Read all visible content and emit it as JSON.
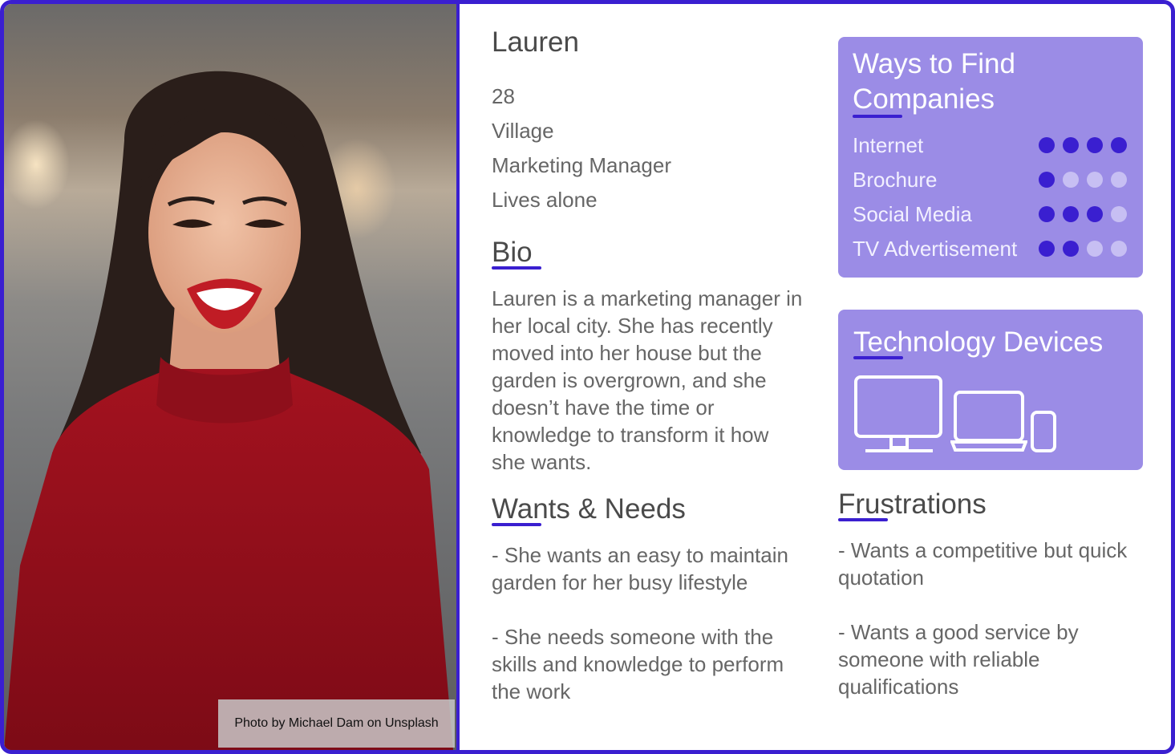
{
  "persona": {
    "name": "Lauren",
    "facts": [
      "28",
      "Village",
      "Marketing Manager",
      "Lives alone"
    ]
  },
  "photo": {
    "credit": "Photo by Michael Dam on Unsplash"
  },
  "bio": {
    "heading": "Bio",
    "text": "Lauren is a marketing manager in\nher local city. She has recently\nmoved into her house but the\ngarden is overgrown, and she\ndoesn’t have the time or\nknowledge to transform it how\nshe wants."
  },
  "wants": {
    "heading": "Wants & Needs",
    "items": [
      "- She wants an easy to maintain\ngarden for her busy lifestyle",
      "- She needs someone with the\nskills and knowledge to perform\nthe work"
    ]
  },
  "ways": {
    "title": "Ways to Find\nCompanies",
    "rows": [
      {
        "label": "Internet",
        "level": 4,
        "max": 4
      },
      {
        "label": "Brochure",
        "level": 1,
        "max": 4
      },
      {
        "label": "Social Media",
        "level": 3,
        "max": 4
      },
      {
        "label": "TV Advertisement",
        "level": 2,
        "max": 4
      }
    ]
  },
  "devices": {
    "title": "Technology Devices",
    "icons": [
      "desktop-monitor-icon",
      "laptop-icon",
      "phone-icon"
    ]
  },
  "frustrations": {
    "heading": "Frustrations",
    "items": [
      "- Wants a competitive but quick\nquotation",
      "- Wants a good service by\nsomeone with reliable\nqualifications"
    ]
  },
  "colors": {
    "accent": "#3a1fd0",
    "card": "#9b8ce6",
    "dot_off": "#c7bff3"
  }
}
